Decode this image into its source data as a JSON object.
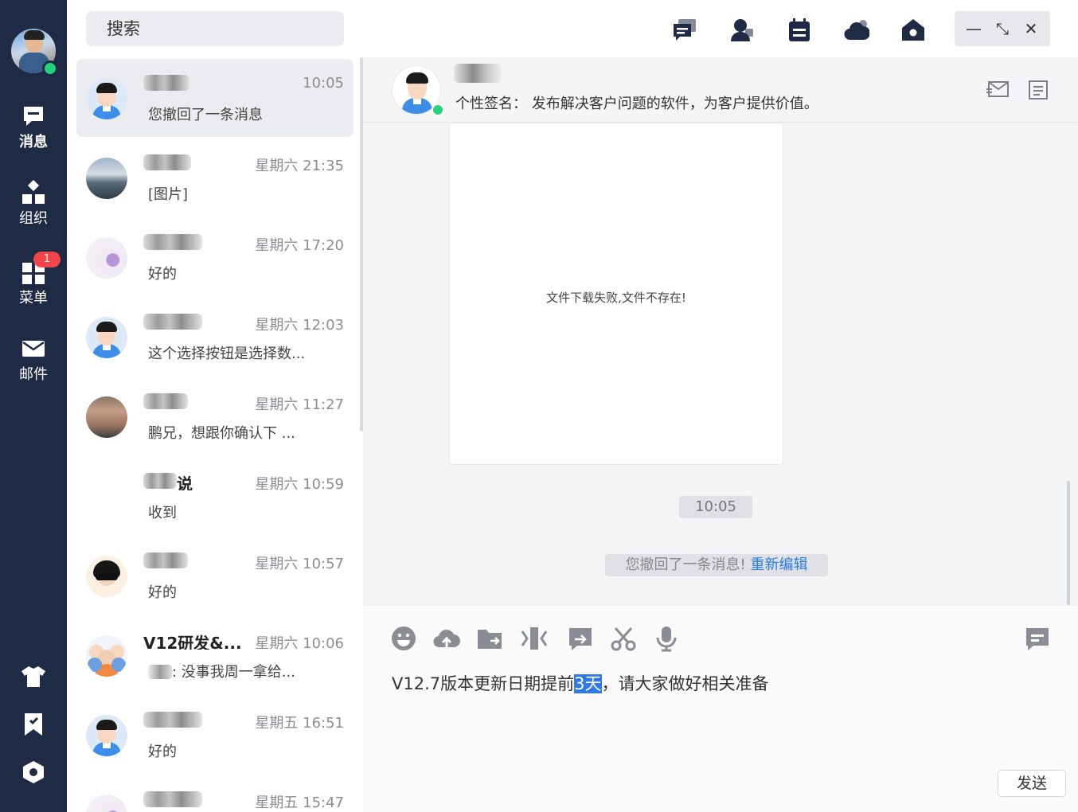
{
  "rail": {
    "items": [
      {
        "label": "消息",
        "icon": "message-icon"
      },
      {
        "label": "组织",
        "icon": "org-icon"
      },
      {
        "label": "菜单",
        "icon": "menu-grid-icon",
        "badge": "1"
      },
      {
        "label": "邮件",
        "icon": "mail-icon"
      }
    ],
    "bottom_icons": [
      "shirt-icon",
      "bookmark-icon",
      "hexagon-settings-icon"
    ]
  },
  "search": {
    "placeholder": "搜索"
  },
  "conversations": [
    {
      "time": "10:05",
      "preview": "您撤回了一条消息"
    },
    {
      "time": "星期六 21:35",
      "preview": "[图片]"
    },
    {
      "time": "星期六 17:20",
      "preview": "好的"
    },
    {
      "time": "星期六 12:03",
      "preview": "这个选择按钮是选择数..."
    },
    {
      "time": "星期六 11:27",
      "preview": "鹏兄，想跟你确认下 ..."
    },
    {
      "name_suffix": "说",
      "time": "星期六 10:59",
      "preview": "收到"
    },
    {
      "time": "星期六 10:57",
      "preview": "好的"
    },
    {
      "name": "V12研发&...",
      "time": "星期六 10:06",
      "preview": ": 没事我周一拿给..."
    },
    {
      "time": "星期五 16:51",
      "preview": "好的"
    },
    {
      "time": "星期五 15:47",
      "preview": ""
    }
  ],
  "topbar": {
    "icons": [
      "chat-bubble-icon",
      "contacts-icon",
      "calendar-icon",
      "cloud-icon",
      "home-icon"
    ],
    "window": {
      "minimize": "—",
      "restore": "⤡",
      "close": "✕"
    }
  },
  "chat": {
    "signature": "个性签名： 发布解决客户问题的软件，为客户提供价值。",
    "file_error": "文件下载失败,文件不存在!",
    "time_label": "10:05",
    "recall_text": "您撤回了一条消息!",
    "recall_link": "重新编辑",
    "input_before": "V12.7版本更新日期提前",
    "input_selected": "3天",
    "input_after": "，请大家做好相关准备",
    "send_label": "发送"
  },
  "colors": {
    "rail_bg": "#1f2a44",
    "accent": "#2f7ae5",
    "online": "#23d27a",
    "badge": "#f2474a"
  }
}
